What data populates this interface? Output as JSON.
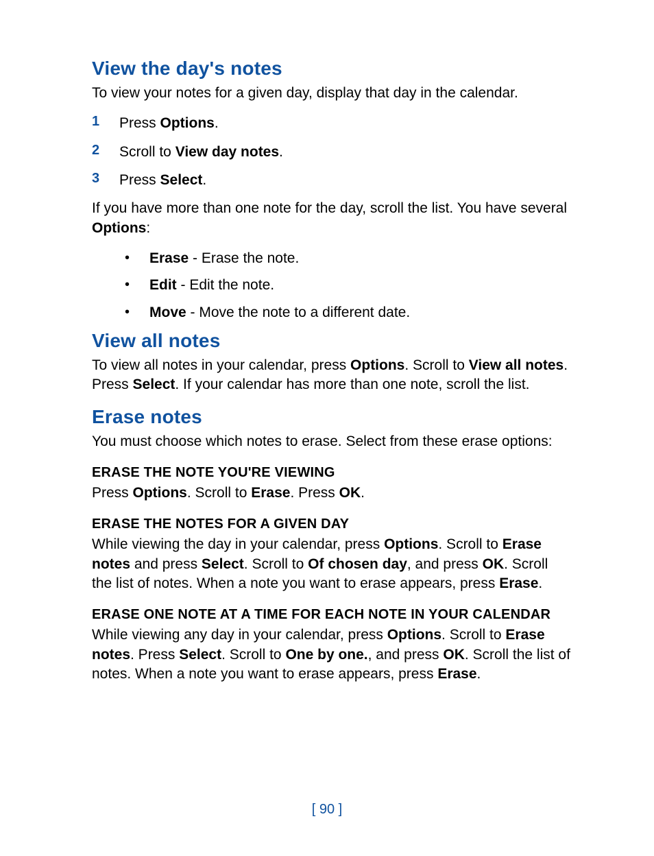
{
  "s1": {
    "title": "View the day's notes",
    "intro": "To view your notes for a given day, display that day in the calendar.",
    "steps": [
      {
        "n": "1",
        "pre": "Press ",
        "bold": "Options",
        "post": "."
      },
      {
        "n": "2",
        "pre": "Scroll to ",
        "bold": "View day notes",
        "post": "."
      },
      {
        "n": "3",
        "pre": "Press ",
        "bold": "Select",
        "post": "."
      }
    ],
    "after_pre": "If you have more than one note for the day, scroll the list. You have several ",
    "after_bold": "Options",
    "after_post": ":",
    "bullets": [
      {
        "b": "Erase",
        "t": " - Erase the note."
      },
      {
        "b": "Edit",
        "t": " - Edit the note."
      },
      {
        "b": "Move",
        "t": " - Move the note to a different date."
      }
    ]
  },
  "s2": {
    "title": "View all notes",
    "p": {
      "t1": "To view all notes in your calendar, press ",
      "b1": "Options",
      "t2": ". Scroll to ",
      "b2": "View all notes",
      "t3": ". Press ",
      "b3": "Select",
      "t4": ". If your calendar has more than one note, scroll the list."
    }
  },
  "s3": {
    "title": "Erase notes",
    "intro": "You must choose which notes to erase. Select from these erase options:",
    "a": {
      "h": "ERASE THE NOTE YOU'RE VIEWING",
      "t1": "Press ",
      "b1": "Options",
      "t2": ". Scroll to ",
      "b2": "Erase",
      "t3": ". Press ",
      "b3": "OK",
      "t4": "."
    },
    "b": {
      "h": "ERASE THE NOTES FOR A GIVEN DAY",
      "t1": "While viewing the day in your calendar, press ",
      "b1": "Options",
      "t2": ". Scroll to ",
      "b2": "Erase notes",
      "t3": " and press ",
      "b3": "Select",
      "t4": ". Scroll to ",
      "b4": "Of chosen day",
      "t5": ", and press ",
      "b5": "OK",
      "t6": ". Scroll the list of notes. When a note you want to erase appears, press ",
      "b6": "Erase",
      "t7": "."
    },
    "c": {
      "h": "ERASE ONE NOTE AT A TIME FOR EACH NOTE IN YOUR CALENDAR",
      "t1": "While viewing any day in your calendar, press ",
      "b1": "Options",
      "t2": ". Scroll to ",
      "b2": "Erase notes",
      "t3": ". Press ",
      "b3": "Select",
      "t4": ". Scroll to ",
      "b4": "One by one.",
      "t5": ", and press ",
      "b5": "OK",
      "t6": ". Scroll the list of notes. When a note you want to erase appears, press ",
      "b6": "Erase",
      "t7": "."
    }
  },
  "page_number": "[ 90 ]"
}
